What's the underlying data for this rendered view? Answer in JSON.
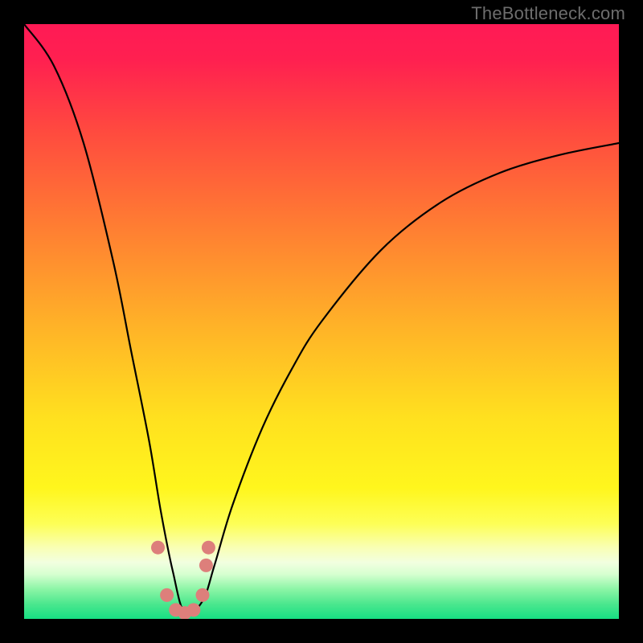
{
  "watermark": "TheBottleneck.com",
  "gradient_stops": [
    {
      "offset": 0.0,
      "color": "#ff1a55"
    },
    {
      "offset": 0.06,
      "color": "#ff2050"
    },
    {
      "offset": 0.18,
      "color": "#ff4a3f"
    },
    {
      "offset": 0.33,
      "color": "#ff7a33"
    },
    {
      "offset": 0.5,
      "color": "#ffb028"
    },
    {
      "offset": 0.66,
      "color": "#ffe01f"
    },
    {
      "offset": 0.78,
      "color": "#fff61d"
    },
    {
      "offset": 0.84,
      "color": "#fdff56"
    },
    {
      "offset": 0.88,
      "color": "#f9ffb4"
    },
    {
      "offset": 0.905,
      "color": "#f2ffe0"
    },
    {
      "offset": 0.925,
      "color": "#d6ffd0"
    },
    {
      "offset": 0.95,
      "color": "#8cf5a6"
    },
    {
      "offset": 0.975,
      "color": "#4be78e"
    },
    {
      "offset": 1.0,
      "color": "#17df83"
    }
  ],
  "chart_data": {
    "type": "line",
    "title": "",
    "xlabel": "",
    "ylabel": "",
    "x_range": [
      0,
      1
    ],
    "y_range": [
      0,
      100
    ],
    "note": "Bottleneck-style V curve. y ≈ 100 at x=0, drops to ~0 near x≈0.27, rises asymptotically toward ~80 at x=1. Percentages are approximate, read from the gradient heatmap position.",
    "series": [
      {
        "name": "bottleneck-curve",
        "x": [
          0.0,
          0.05,
          0.1,
          0.15,
          0.18,
          0.21,
          0.23,
          0.25,
          0.27,
          0.3,
          0.32,
          0.35,
          0.4,
          0.45,
          0.5,
          0.6,
          0.7,
          0.8,
          0.9,
          1.0
        ],
        "y": [
          100.0,
          93.0,
          80.0,
          60.0,
          45.0,
          30.0,
          18.0,
          8.0,
          1.0,
          3.0,
          9.0,
          19.0,
          32.0,
          42.0,
          50.0,
          62.0,
          70.0,
          75.0,
          78.0,
          80.0
        ]
      }
    ],
    "markers": {
      "name": "highlight-dots",
      "color": "#dd7f7b",
      "points_xy": [
        [
          0.225,
          12.0
        ],
        [
          0.24,
          4.0
        ],
        [
          0.255,
          1.5
        ],
        [
          0.27,
          1.0
        ],
        [
          0.285,
          1.5
        ],
        [
          0.3,
          4.0
        ],
        [
          0.306,
          9.0
        ],
        [
          0.31,
          12.0
        ]
      ]
    }
  }
}
